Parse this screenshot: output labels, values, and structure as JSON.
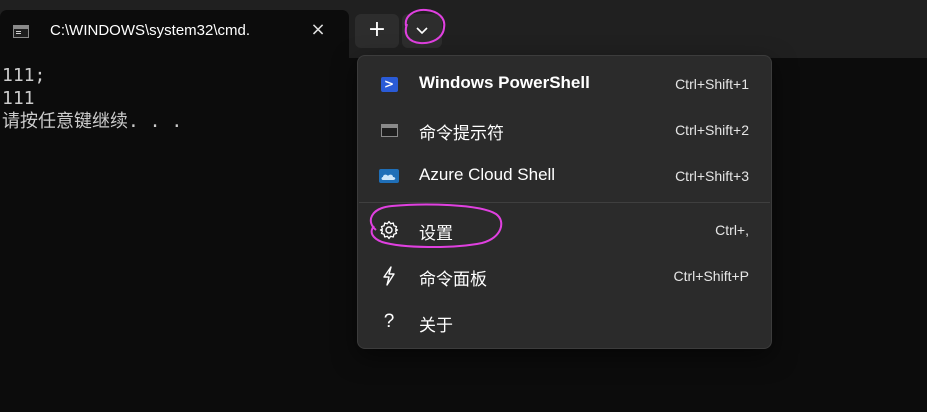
{
  "tab": {
    "title": "C:\\WINDOWS\\system32\\cmd.",
    "close_glyph": "×",
    "icon": "cmd-icon"
  },
  "toolbar": {
    "new_tab_glyph": "+",
    "dropdown_icon": "chevron-down-icon"
  },
  "terminal": {
    "lines": [
      "111;",
      "111",
      "请按任意键继续. . ."
    ]
  },
  "menu": {
    "items": [
      {
        "label": "Windows PowerShell",
        "shortcut": "Ctrl+Shift+1",
        "icon": "powershell-icon"
      },
      {
        "label": "命令提示符",
        "shortcut": "Ctrl+Shift+2",
        "icon": "cmd-icon"
      },
      {
        "label": "Azure Cloud Shell",
        "shortcut": "Ctrl+Shift+3",
        "icon": "azure-cloud-icon"
      },
      {
        "label": "设置",
        "shortcut": "Ctrl+,",
        "icon": "gear-icon"
      },
      {
        "label": "命令面板",
        "shortcut": "Ctrl+Shift+P",
        "icon": "lightning-icon"
      },
      {
        "label": "关于",
        "shortcut": "",
        "icon": "question-icon"
      }
    ]
  },
  "colors": {
    "titlebar": "#202020",
    "terminal_bg": "#0c0c0c",
    "menu_bg": "#2b2b2b",
    "annotation": "#e040e0"
  }
}
